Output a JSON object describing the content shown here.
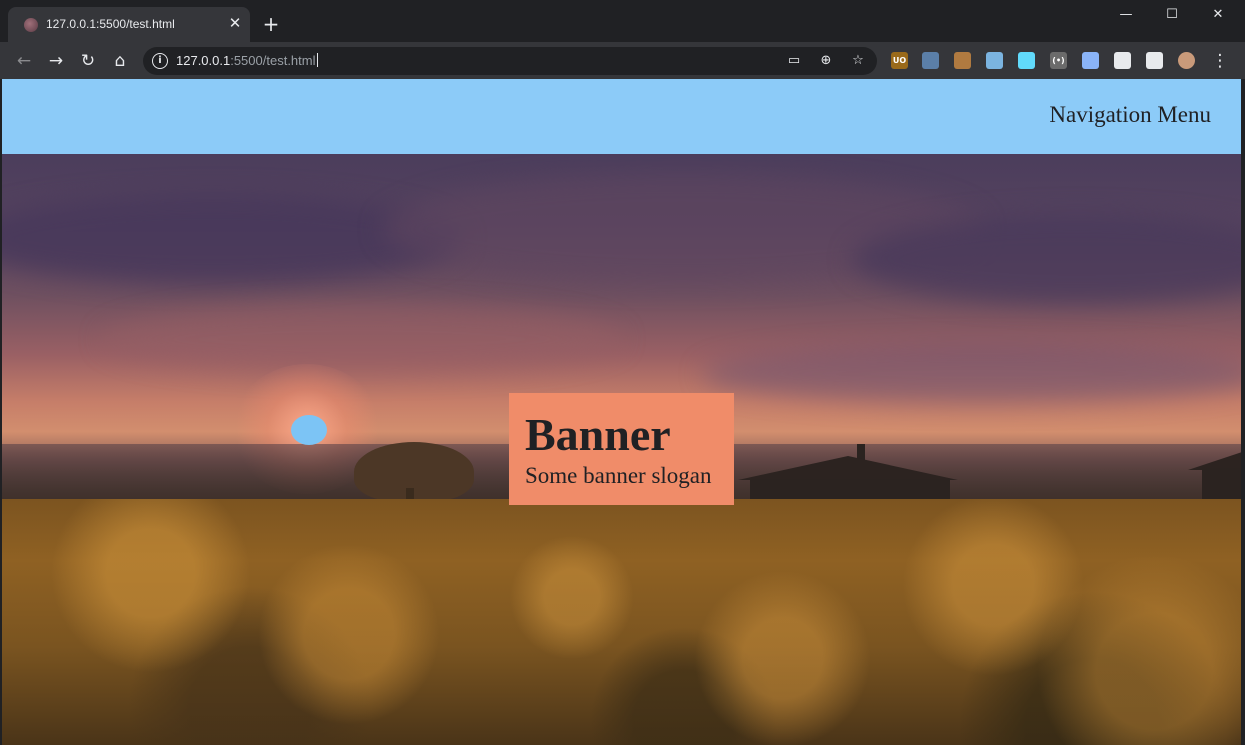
{
  "browser": {
    "tab": {
      "title": "127.0.0.1:5500/test.html",
      "close_glyph": "✕"
    },
    "new_tab_glyph": "+",
    "window_controls": {
      "minimize": "—",
      "maximize": "☐",
      "close": "✕"
    },
    "nav_buttons": {
      "back": "←",
      "forward": "→",
      "reload": "↻",
      "home": "⌂"
    },
    "address": {
      "host": "127.0.0.1",
      "path": ":5500/test.html"
    },
    "omnibox_icons": [
      "cast-icon",
      "zoom-icon",
      "bookmark-star-icon"
    ],
    "extensions": [
      {
        "name": "ublock-icon",
        "label": "UO",
        "color": "#9a6a1a"
      },
      {
        "name": "ext-square-icon",
        "label": "",
        "color": "#5b7fa8"
      },
      {
        "name": "ext-chart-icon",
        "label": "",
        "color": "#b07a40"
      },
      {
        "name": "ext-search-icon",
        "label": "",
        "color": "#7bb4e0"
      },
      {
        "name": "react-devtools-icon",
        "label": "",
        "color": "#61dafb"
      },
      {
        "name": "ext-bracket-icon",
        "label": "(•)",
        "color": "#6b6b6b"
      },
      {
        "name": "ext-note-icon",
        "label": "",
        "color": "#8ab4f8"
      },
      {
        "name": "extensions-puzzle-icon",
        "label": "",
        "color": "#e8eaed"
      },
      {
        "name": "media-control-icon",
        "label": "",
        "color": "#e8eaed"
      },
      {
        "name": "profile-avatar-icon",
        "label": "",
        "color": "#c99a7a"
      }
    ],
    "menu_glyph": "⋮"
  },
  "page": {
    "nav": {
      "menu_label": "Navigation Menu",
      "bg_color": "#8ccbf8"
    },
    "banner": {
      "title": "Banner",
      "slogan": "Some banner slogan",
      "bg_color": "#f08c69"
    }
  }
}
